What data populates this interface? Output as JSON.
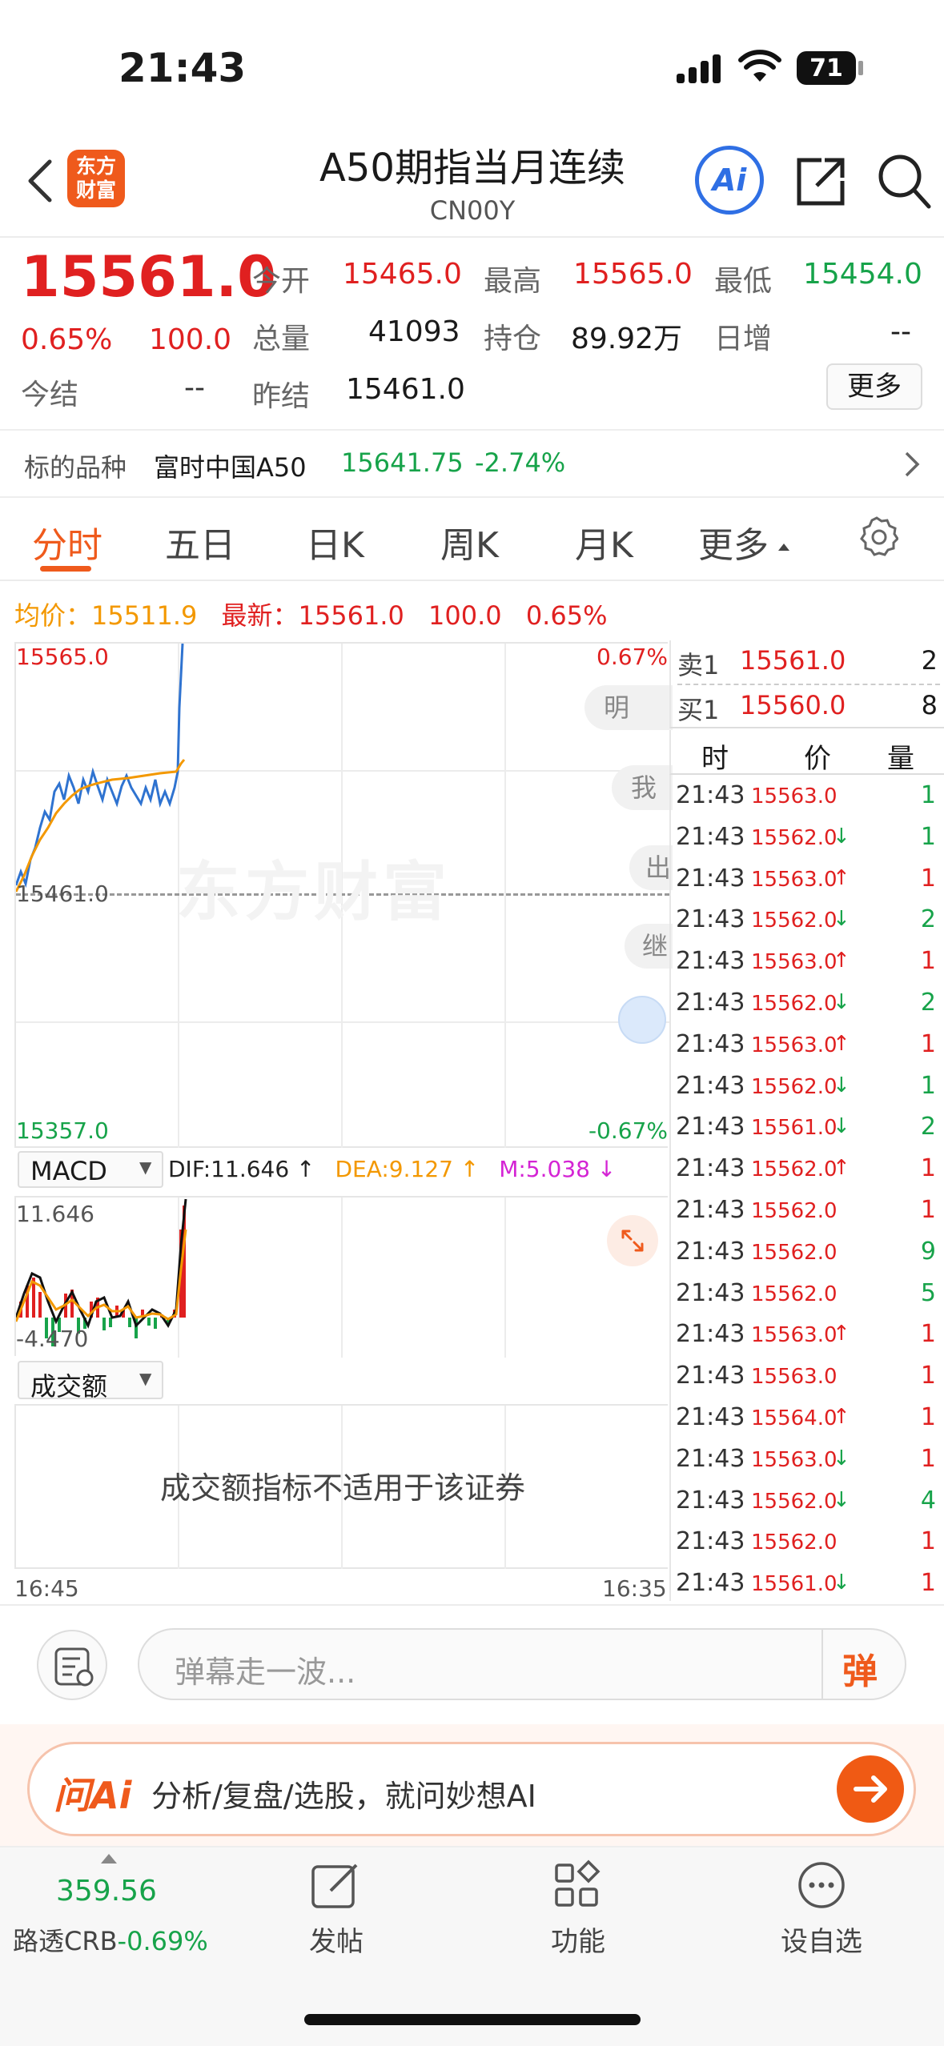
{
  "status_bar": {
    "time": "21:43",
    "battery": "71"
  },
  "header": {
    "title": "A50期指当月连续",
    "code": "CN00Y",
    "logo_text_1": "东方",
    "logo_text_2": "财富",
    "ai_label": "Ai"
  },
  "quote": {
    "price": "15561.0",
    "change_pct": "0.65%",
    "change": "100.0",
    "open_label": "今开",
    "open": "15465.0",
    "high_label": "最高",
    "high": "15565.0",
    "low_label": "最低",
    "low": "15454.0",
    "volume_label": "总量",
    "volume": "41093",
    "oi_label": "持仓",
    "oi": "89.92万",
    "daily_inc_label": "日增",
    "daily_inc": "--",
    "settle_label": "今结",
    "settle": "--",
    "prev_settle_label": "昨结",
    "prev_settle": "15461.0",
    "more": "更多"
  },
  "underlying": {
    "label": "标的品种",
    "name": "富时中国A50",
    "price": "15641.75",
    "pct": "-2.74%"
  },
  "tabs": [
    "分时",
    "五日",
    "日K",
    "周K",
    "月K",
    "更多"
  ],
  "info_line": {
    "avg_label": "均价：",
    "avg": "15511.9",
    "latest_label": "最新：",
    "latest": "15561.0",
    "chg": "100.0",
    "pct": "0.65%"
  },
  "chart": {
    "top_price": "15565.0",
    "top_pct": "0.67%",
    "mid_price": "15461.0",
    "bottom_price": "15357.0",
    "bottom_pct": "-0.67%",
    "watermark": "东方财富",
    "time_start": "16:45",
    "time_end": "16:35"
  },
  "danmaku": [
    "明天",
    "我有",
    "出",
    "继"
  ],
  "macd": {
    "label": "MACD",
    "dif": "DIF:11.646 ↑",
    "dea": "DEA:9.127 ↑",
    "m": "M:5.038 ↓",
    "top": "11.646",
    "bottom": "-4.470"
  },
  "turnover": {
    "label": "成交额",
    "message": "成交额指标不适用于该证券"
  },
  "order_book": [
    {
      "side": "卖1",
      "price": "15561.0",
      "qty": "2"
    },
    {
      "side": "买1",
      "price": "15560.0",
      "qty": "8"
    }
  ],
  "ticks_header": {
    "time": "时",
    "price": "价",
    "qty": "量"
  },
  "ticks": [
    {
      "t": "21:43",
      "p": "15563.0",
      "a": "",
      "q": "1",
      "qc": "green"
    },
    {
      "t": "21:43",
      "p": "15562.0",
      "a": "↓",
      "q": "1",
      "qc": "green"
    },
    {
      "t": "21:43",
      "p": "15563.0",
      "a": "↑",
      "q": "1",
      "qc": "red"
    },
    {
      "t": "21:43",
      "p": "15562.0",
      "a": "↓",
      "q": "2",
      "qc": "green"
    },
    {
      "t": "21:43",
      "p": "15563.0",
      "a": "↑",
      "q": "1",
      "qc": "red"
    },
    {
      "t": "21:43",
      "p": "15562.0",
      "a": "↓",
      "q": "2",
      "qc": "green"
    },
    {
      "t": "21:43",
      "p": "15563.0",
      "a": "↑",
      "q": "1",
      "qc": "red"
    },
    {
      "t": "21:43",
      "p": "15562.0",
      "a": "↓",
      "q": "1",
      "qc": "green"
    },
    {
      "t": "21:43",
      "p": "15561.0",
      "a": "↓",
      "q": "2",
      "qc": "green"
    },
    {
      "t": "21:43",
      "p": "15562.0",
      "a": "↑",
      "q": "1",
      "qc": "red"
    },
    {
      "t": "21:43",
      "p": "15562.0",
      "a": "",
      "q": "1",
      "qc": "red"
    },
    {
      "t": "21:43",
      "p": "15562.0",
      "a": "",
      "q": "9",
      "qc": "green"
    },
    {
      "t": "21:43",
      "p": "15562.0",
      "a": "",
      "q": "5",
      "qc": "green"
    },
    {
      "t": "21:43",
      "p": "15563.0",
      "a": "↑",
      "q": "1",
      "qc": "red"
    },
    {
      "t": "21:43",
      "p": "15563.0",
      "a": "",
      "q": "1",
      "qc": "red"
    },
    {
      "t": "21:43",
      "p": "15564.0",
      "a": "↑",
      "q": "1",
      "qc": "red"
    },
    {
      "t": "21:43",
      "p": "15563.0",
      "a": "↓",
      "q": "1",
      "qc": "red"
    },
    {
      "t": "21:43",
      "p": "15562.0",
      "a": "↓",
      "q": "4",
      "qc": "green"
    },
    {
      "t": "21:43",
      "p": "15562.0",
      "a": "",
      "q": "1",
      "qc": "red"
    },
    {
      "t": "21:43",
      "p": "15561.0",
      "a": "↓",
      "q": "1",
      "qc": "red"
    }
  ],
  "comment": {
    "placeholder": "弹幕走一波...",
    "danmu_btn": "弹"
  },
  "ai_bar": {
    "brand": "问Ai",
    "text": "分析/复盘/选股，就问妙想AI"
  },
  "bottom_nav": {
    "ticker_value": "359.56",
    "ticker_label": "路透CRB",
    "ticker_pct": "-0.69%",
    "post": "发帖",
    "functions": "功能",
    "watchlist": "设自选"
  }
}
